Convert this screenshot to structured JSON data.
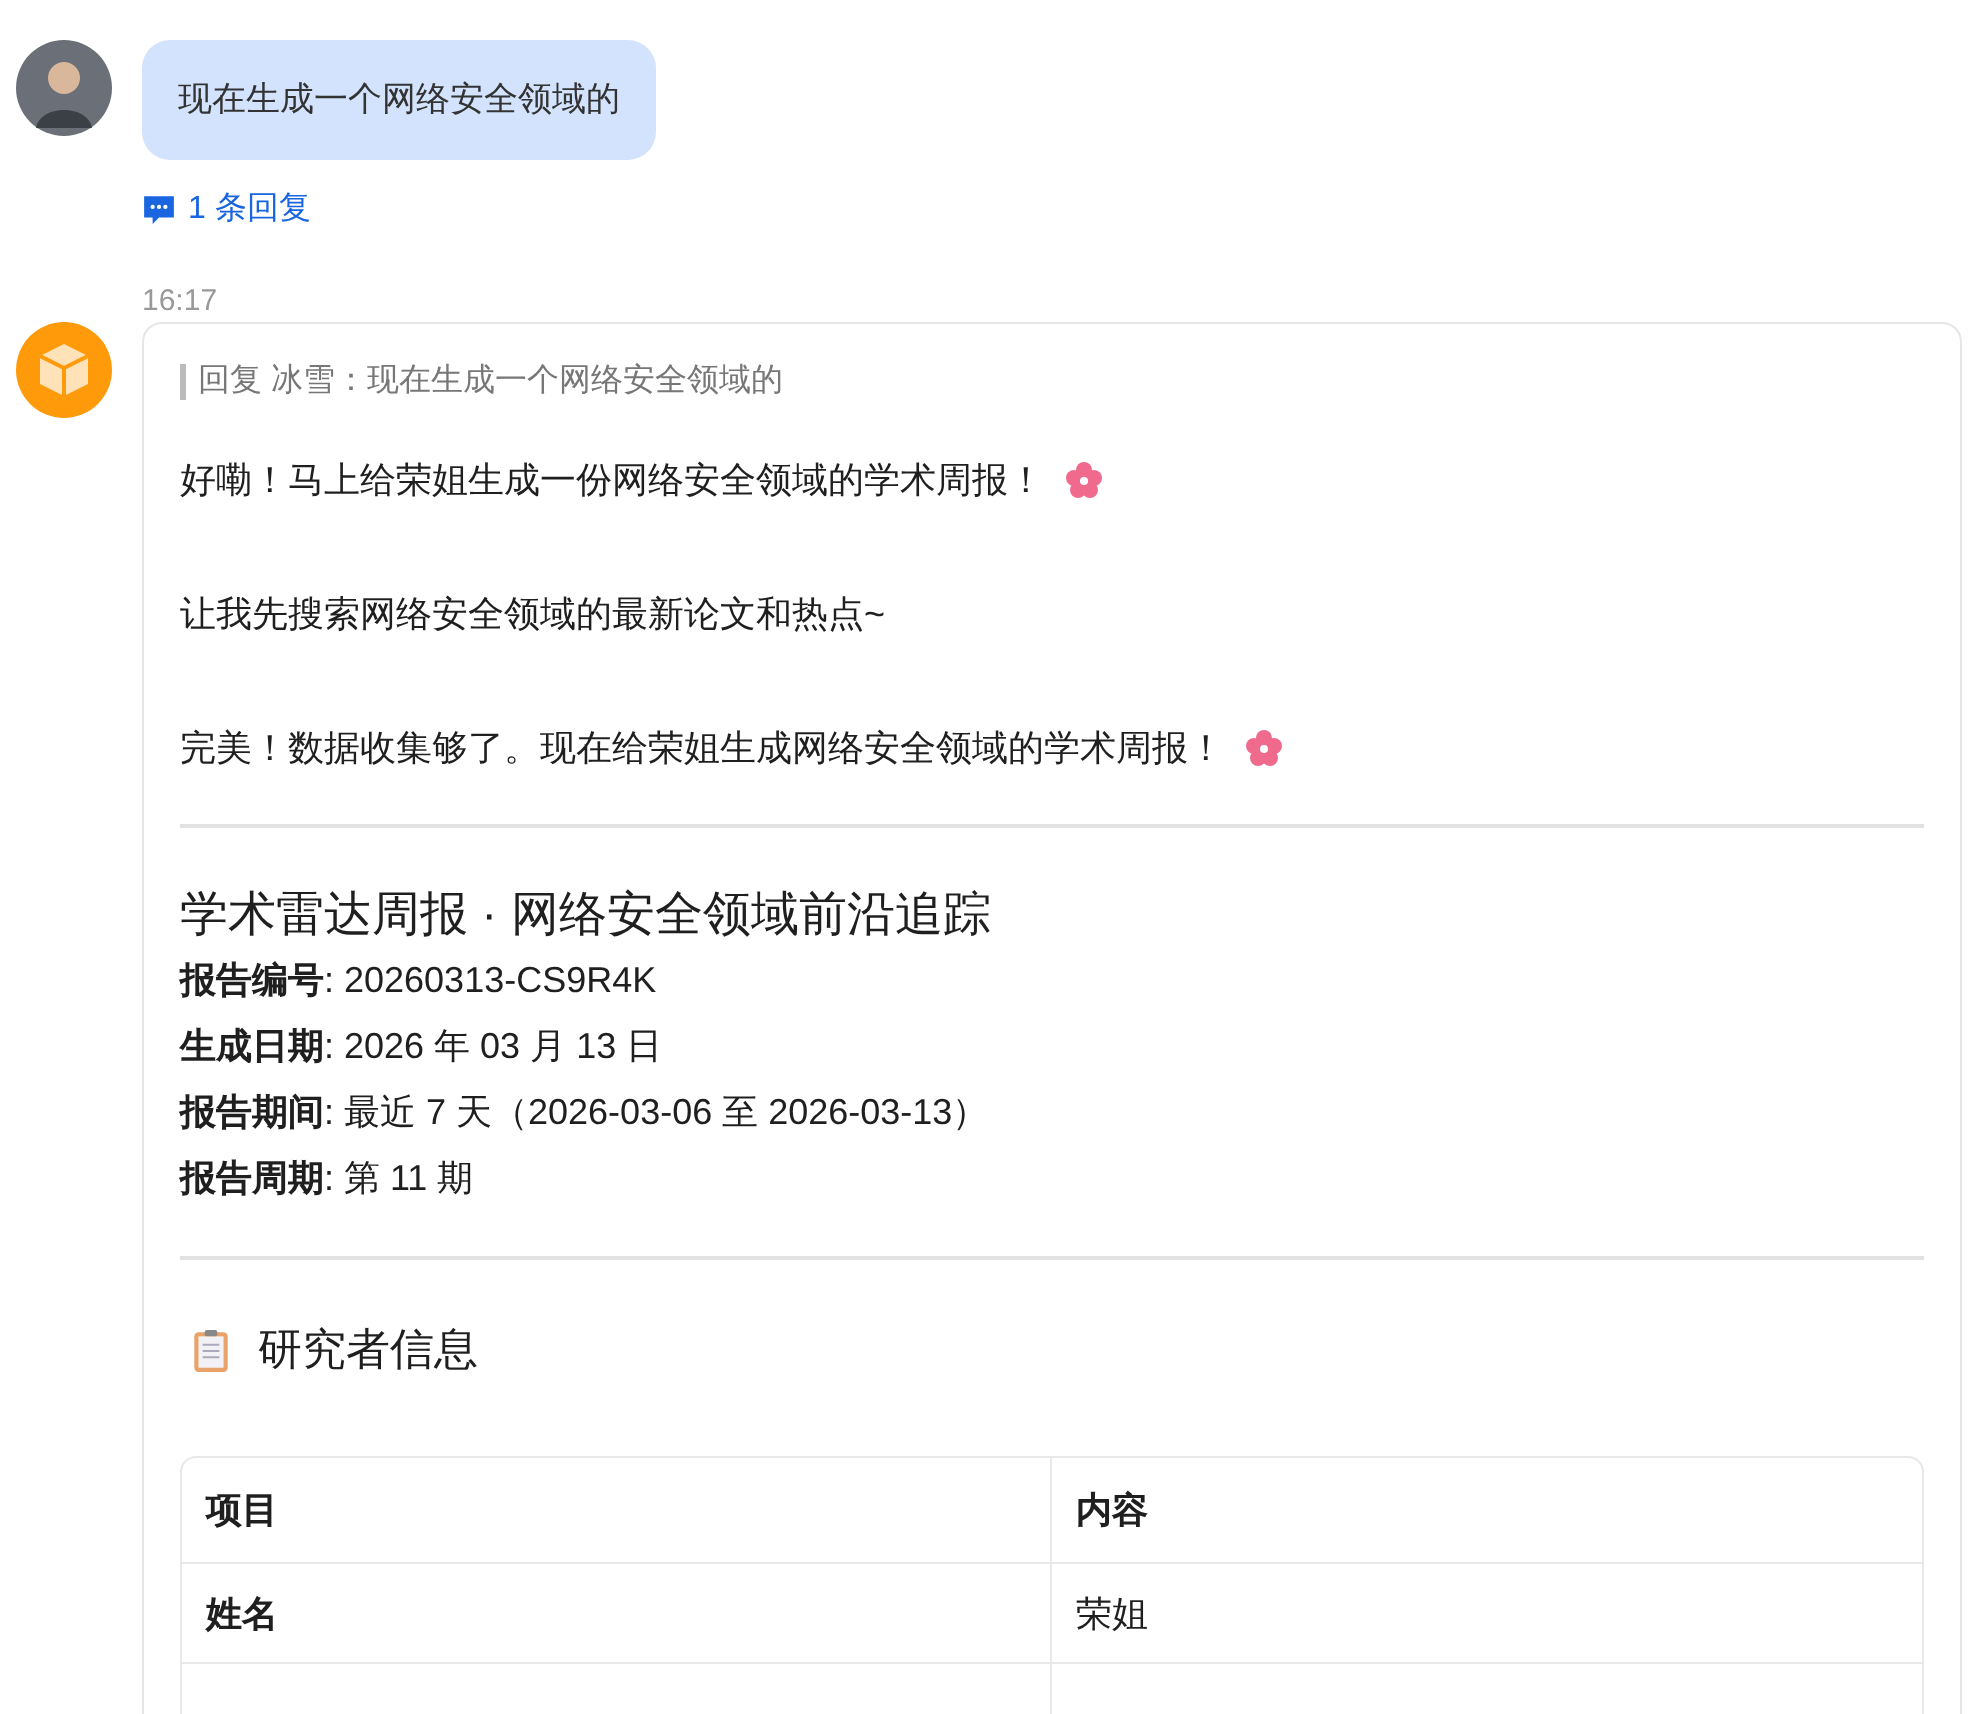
{
  "user_message": {
    "text": "现在生成一个网络安全领域的",
    "replies": "1 条回复"
  },
  "bot_message": {
    "time": "16:17",
    "quote": "回复 冰雪：现在生成一个网络安全领域的",
    "paragraphs": [
      {
        "text": "好嘞！马上给荣姐生成一份网络安全领域的学术周报！",
        "flower": true
      },
      {
        "text": "让我先搜索网络安全领域的最新论文和热点~",
        "flower": false
      },
      {
        "text": "完美！数据收集够了。现在给荣姐生成网络安全领域的学术周报！",
        "flower": true
      }
    ],
    "report_title": "学术雷达周报 · 网络安全领域前沿追踪",
    "meta": [
      {
        "label": "报告编号",
        "value": ": 20260313-CS9R4K"
      },
      {
        "label": "生成日期",
        "value": ": 2026 年 03 月 13 日"
      },
      {
        "label": "报告期间",
        "value": ": 最近 7 天（2026-03-06 至 2026-03-13）"
      },
      {
        "label": "报告周期",
        "value": ": 第 11 期"
      }
    ],
    "section_title": "研究者信息",
    "table": {
      "columns": [
        "项目",
        "内容"
      ],
      "rows": [
        [
          "姓名",
          "荣姐"
        ]
      ]
    }
  }
}
